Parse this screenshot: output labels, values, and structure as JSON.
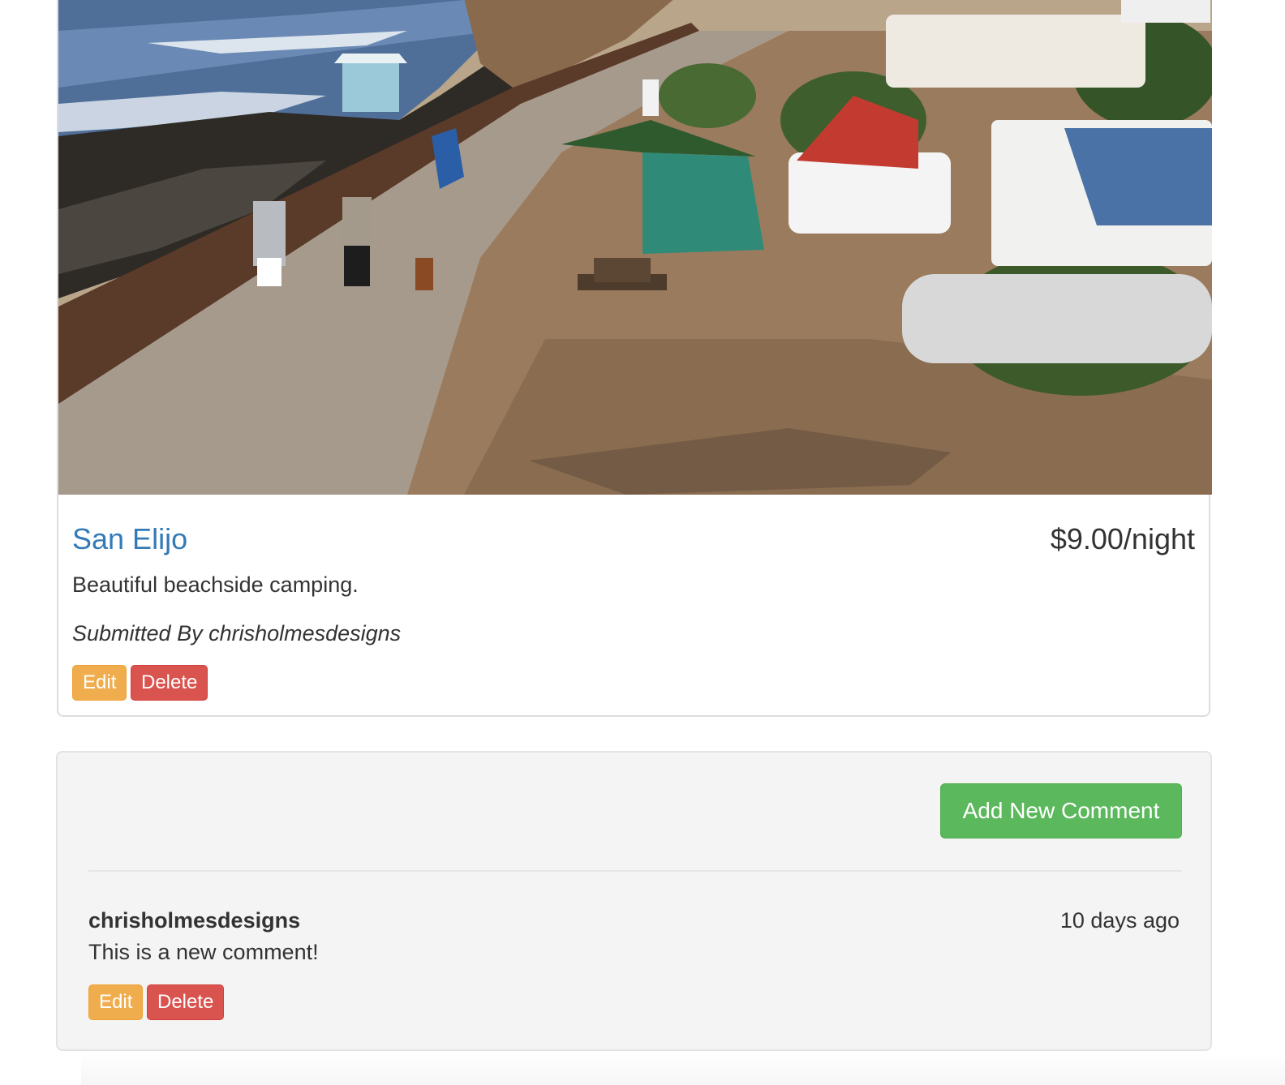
{
  "campground": {
    "image_alt": "Beachside campground with path, tents and RVs",
    "name": "San Elijo",
    "price": "$9.00/night",
    "description": "Beautiful beachside camping.",
    "submitted_by": "Submitted By chrisholmesdesigns",
    "edit_label": "Edit",
    "delete_label": "Delete"
  },
  "comments": {
    "add_label": "Add New Comment",
    "items": [
      {
        "author": "chrisholmesdesigns",
        "time": "10 days ago",
        "text": "This is a new comment!",
        "edit_label": "Edit",
        "delete_label": "Delete"
      }
    ]
  },
  "colors": {
    "link": "#337ab7",
    "warning": "#f0ad4e",
    "danger": "#d9534f",
    "success": "#5cb85c",
    "well": "#f4f4f4"
  }
}
